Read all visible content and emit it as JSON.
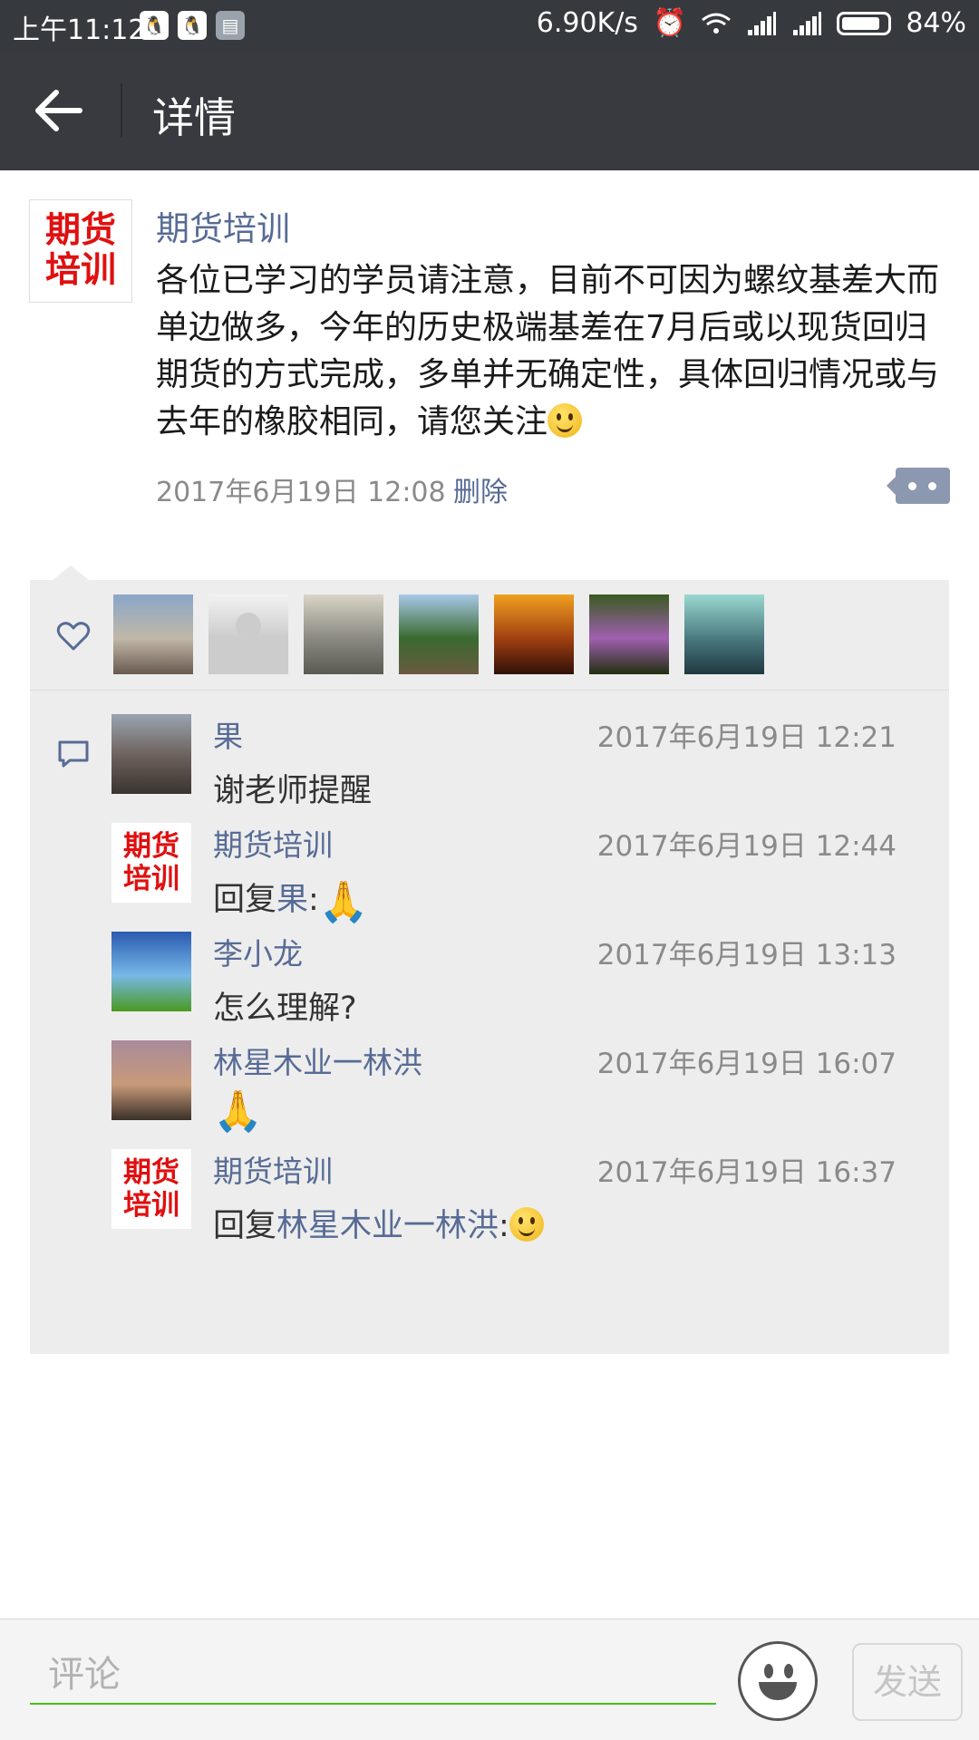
{
  "status_bar": {
    "time": "上午11:12",
    "speed": "6.90K/s",
    "battery": "84%",
    "battery_level": 0.84,
    "left_icons": [
      "qq-icon",
      "qq-icon",
      "note-icon"
    ],
    "right_icons": [
      "alarm-icon",
      "wifi-icon",
      "signal-icon",
      "signal-icon",
      "battery-icon"
    ]
  },
  "header": {
    "title": "详情",
    "back_icon": "back-arrow-icon"
  },
  "post": {
    "author": "期货培训",
    "avatar_text_line1": "期货",
    "avatar_text_line2": "培训",
    "text": "各位已学习的学员请注意，目前不可因为螺纹基差大而单边做多，今年的历史极端基差在7月后或以现货回归期货的方式完成，多单并无确定性，具体回归情况或与去年的橡胶相同，请您关注",
    "text_emoji": "smile-emoji",
    "timestamp": "2017年6月19日 12:08",
    "delete_label": "删除",
    "more_icon": "more-dots-icon",
    "accent_color": "#576b95"
  },
  "likes": {
    "icon": "heart-icon",
    "avatars": [
      {
        "name": "like-avatar-statue",
        "colors": [
          "#8aa6c8",
          "#c0b8a8",
          "#6a5a50"
        ]
      },
      {
        "name": "like-avatar-default",
        "colors": [
          "#f2f2f2",
          "#cccccc",
          "#cccccc"
        ]
      },
      {
        "name": "like-avatar-painting",
        "colors": [
          "#d8d4c8",
          "#8a8a80",
          "#5a5a50"
        ]
      },
      {
        "name": "like-avatar-garden",
        "colors": [
          "#a8c8e8",
          "#3a6a30",
          "#6a5a40"
        ]
      },
      {
        "name": "like-avatar-sunset",
        "colors": [
          "#f0a020",
          "#a04010",
          "#301008"
        ]
      },
      {
        "name": "like-avatar-flowers",
        "colors": [
          "#3a5a20",
          "#a060b0",
          "#203010"
        ]
      },
      {
        "name": "like-avatar-portrait",
        "colors": [
          "#9ad8d0",
          "#4a7a80",
          "#203840"
        ]
      }
    ]
  },
  "comments": {
    "icon": "comment-icon",
    "items": [
      {
        "name": "果",
        "time": "2017年6月19日 12:21",
        "text": "谢老师提醒",
        "avatar": "photo",
        "colors": [
          "#9aa4b0",
          "#6a5e58",
          "#3a3430"
        ]
      },
      {
        "name": "期货培训",
        "time": "2017年6月19日 12:44",
        "reply_prefix": "回复",
        "reply_to": "果",
        "reply_suffix": ":",
        "emoji": "pray-emoji",
        "avatar": "logo"
      },
      {
        "name": "李小龙",
        "time": "2017年6月19日 13:13",
        "text": "怎么理解?",
        "avatar": "photo",
        "colors": [
          "#2a5ab0",
          "#78b8e8",
          "#4a9a20"
        ]
      },
      {
        "name": "林星木业一林洪",
        "time": "2017年6月19日 16:07",
        "text": "",
        "emoji": "pray-emoji",
        "avatar": "photo",
        "colors": [
          "#a88a9a",
          "#c89a7a",
          "#3a3028"
        ]
      },
      {
        "name": "期货培训",
        "time": "2017年6月19日 16:37",
        "reply_prefix": "回复",
        "reply_to": "林星木业一林洪",
        "reply_suffix": ":",
        "emoji": "smile-emoji",
        "avatar": "logo"
      }
    ]
  },
  "input_bar": {
    "placeholder": "评论",
    "value": "",
    "emoji_icon": "emoji-face-icon",
    "send_label": "发送",
    "underline_color": "#45c01a"
  }
}
